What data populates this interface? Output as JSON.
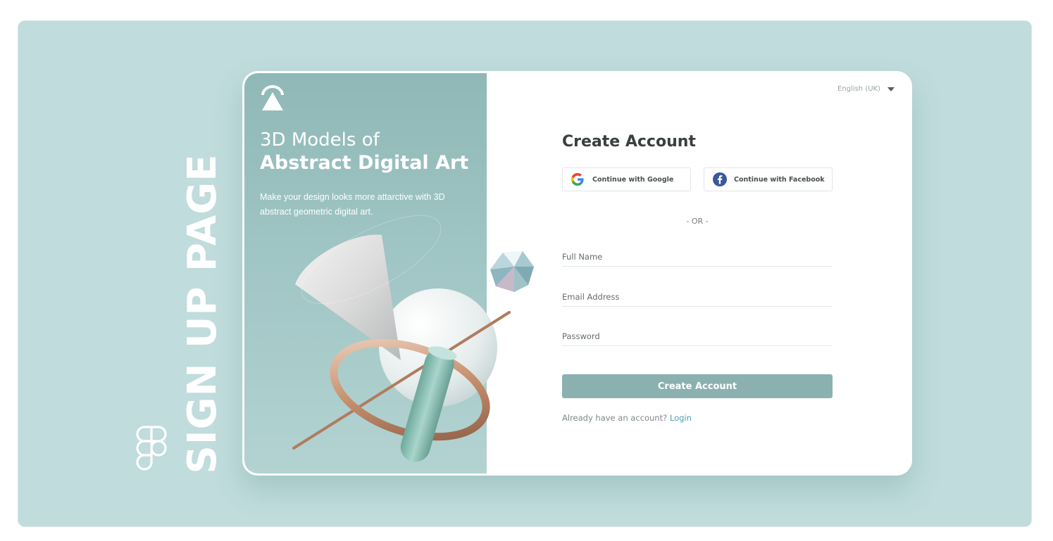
{
  "banner": {
    "side_title": "SIGN UP PAGE",
    "figma_logo_icon": "figma-icon"
  },
  "hero": {
    "logo_icon": "brand-triangle-icon",
    "title_line1": "3D Models of",
    "title_line2": "Abstract Digital Art",
    "description": "Make your design looks more attarctive with 3D abstract geometric digital art."
  },
  "language": {
    "label": "English (UK)",
    "icon": "caret-down-icon"
  },
  "form": {
    "title": "Create Account",
    "google_label": "Continue with Google",
    "facebook_label": "Continue with Facebook",
    "separator": "- OR -",
    "full_name_placeholder": "Full Name",
    "email_placeholder": "Email Address",
    "password_placeholder": "Password",
    "submit_label": "Create Account",
    "login_prompt": "Already have an account?",
    "login_link": "Login"
  },
  "colors": {
    "background": "#c0dcdc",
    "panel": "#9fc5c4",
    "accent": "#8ab1b0",
    "link": "#4e9fae",
    "heading": "#3a3f3f"
  }
}
